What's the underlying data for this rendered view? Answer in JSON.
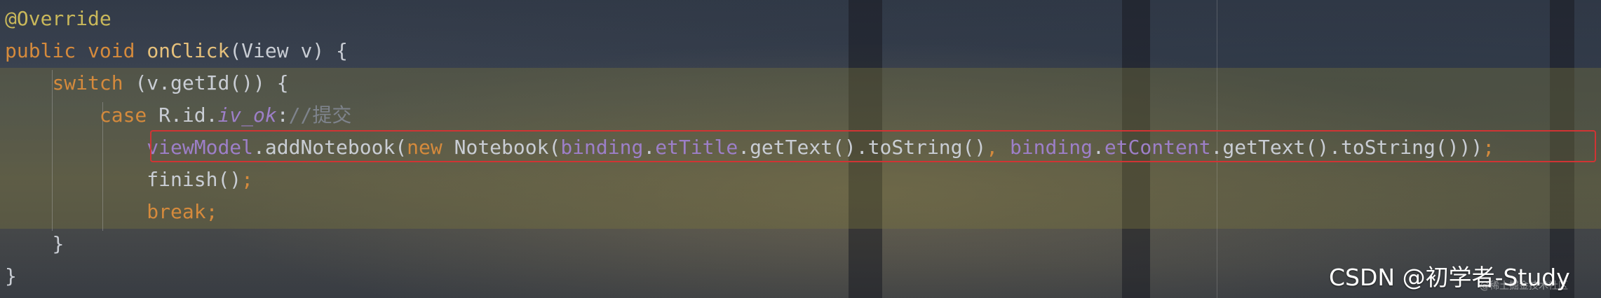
{
  "editor": {
    "lines": [
      {
        "indent": 0,
        "tokens": [
          {
            "t": "@Override",
            "c": "ann"
          }
        ]
      },
      {
        "indent": 0,
        "tokens": [
          {
            "t": "public ",
            "c": "kw"
          },
          {
            "t": "void ",
            "c": "kw"
          },
          {
            "t": "onClick",
            "c": "fn"
          },
          {
            "t": "(View v) {",
            "c": "plain"
          }
        ]
      },
      {
        "indent": 1,
        "tokens": [
          {
            "t": "switch ",
            "c": "kw"
          },
          {
            "t": "(v.getId()) {",
            "c": "plain"
          }
        ]
      },
      {
        "indent": 2,
        "tokens": [
          {
            "t": "case ",
            "c": "kw"
          },
          {
            "t": "R.id.",
            "c": "plain"
          },
          {
            "t": "iv_ok",
            "c": "ital"
          },
          {
            "t": ":",
            "c": "plain"
          },
          {
            "t": "//提交",
            "c": "cmt"
          }
        ]
      },
      {
        "indent": 3,
        "tokens": [
          {
            "t": "viewModel",
            "c": "fld"
          },
          {
            "t": ".addNotebook(",
            "c": "plain"
          },
          {
            "t": "new ",
            "c": "kw"
          },
          {
            "t": "Notebook(",
            "c": "plain"
          },
          {
            "t": "binding",
            "c": "fld"
          },
          {
            "t": ".",
            "c": "plain"
          },
          {
            "t": "etTitle",
            "c": "fld"
          },
          {
            "t": ".getText().toString()",
            "c": "plain"
          },
          {
            "t": ", ",
            "c": "kw"
          },
          {
            "t": "binding",
            "c": "fld"
          },
          {
            "t": ".",
            "c": "plain"
          },
          {
            "t": "etContent",
            "c": "fld"
          },
          {
            "t": ".getText().toString()))",
            "c": "plain"
          },
          {
            "t": ";",
            "c": "kw"
          }
        ]
      },
      {
        "indent": 3,
        "tokens": [
          {
            "t": "finish()",
            "c": "plain"
          },
          {
            "t": ";",
            "c": "kw"
          }
        ]
      },
      {
        "indent": 3,
        "tokens": [
          {
            "t": "break",
            "c": "kw"
          },
          {
            "t": ";",
            "c": "kw"
          }
        ]
      },
      {
        "indent": 1,
        "tokens": [
          {
            "t": "}",
            "c": "plain"
          }
        ]
      },
      {
        "indent": 0,
        "tokens": [
          {
            "t": "}",
            "c": "plain"
          }
        ]
      }
    ]
  },
  "watermark": {
    "main": "CSDN @初学者-Study",
    "sub": "@稀土掘金技术社区"
  }
}
